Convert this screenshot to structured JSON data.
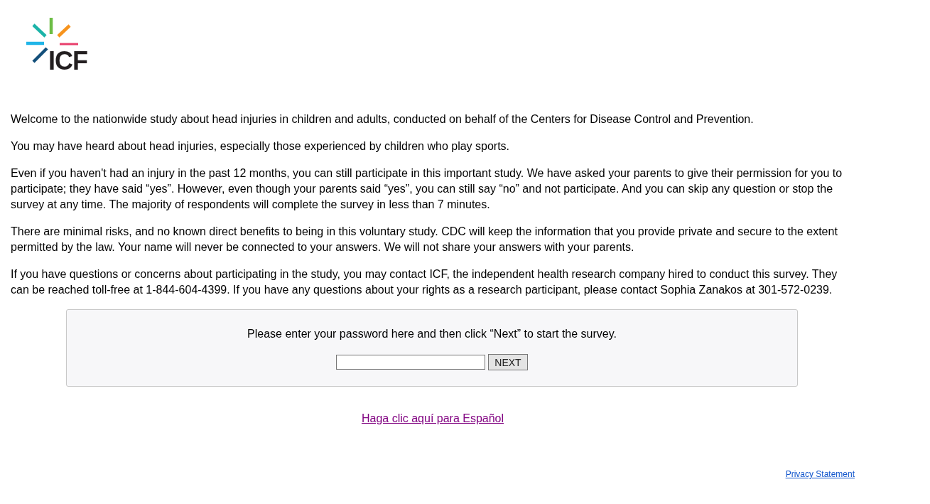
{
  "logo": {
    "text": "ICF"
  },
  "paragraphs": [
    "Welcome to the nationwide study about head injuries in children and adults, conducted on behalf of the Centers for Disease Control and Prevention.",
    "You may have heard about head injuries, especially those experienced by children who play sports.",
    "Even if you haven't had an injury in the past 12 months, you can still participate in this important study. We have asked your parents to give their permission for you to participate; they have said “yes”. However, even though your parents said “yes”, you can still say “no” and not participate. And you can skip any question or stop the survey at any time. The majority of respondents will complete the survey in less than 7 minutes.",
    "There are minimal risks, and no known direct benefits to being in this voluntary study. CDC will keep the information that you provide private and secure to the extent permitted by the law. Your name will never be connected to your answers. We will not share your answers with your parents.",
    "If you have questions or concerns about participating in the study, you may contact ICF, the independent health research company hired to conduct this survey. They can be reached toll-free at 1-844-604-4399. If you have any questions about your rights as a research participant, please contact Sophia Zanakos at 301-572-0239."
  ],
  "login": {
    "prompt": "Please enter your password here and then click “Next” to start the survey.",
    "button": "NEXT"
  },
  "spanish_link": "Haga clic aquí para Español",
  "privacy_link": "Privacy Statement"
}
